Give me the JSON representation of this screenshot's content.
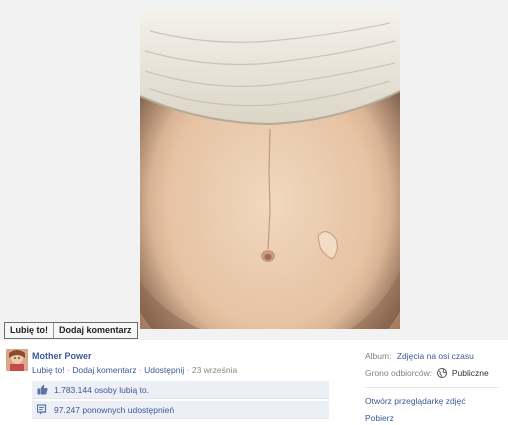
{
  "photo_actions": {
    "like_label": "Lubię to!",
    "comment_label": "Dodaj komentarz"
  },
  "post": {
    "author": "Mother Power",
    "like_link": "Lubię to!",
    "comment_link": "Dodaj komentarz",
    "share_link": "Udostępnij",
    "date": "23 września",
    "separator": "·"
  },
  "ufi": {
    "likes_count": "1.783.144",
    "likes_rest": "osoby lubią to.",
    "shares_count": "97.247",
    "shares_rest": "ponownych udostępnień"
  },
  "sidebar": {
    "album_label": "Album:",
    "album_value": "Zdjęcia na osi czasu",
    "audience_label": "Grono odbiorców:",
    "audience_value": "Publiczne",
    "open_viewer": "Otwórz przeglądarkę zdjęć",
    "download": "Pobierz"
  },
  "colors": {
    "link": "#3b5998",
    "ufi_bg": "#eceff5",
    "photo_bg": "#f2f2f2"
  },
  "icons": [
    "thumbs-up-icon",
    "share-icon",
    "globe-icon"
  ]
}
